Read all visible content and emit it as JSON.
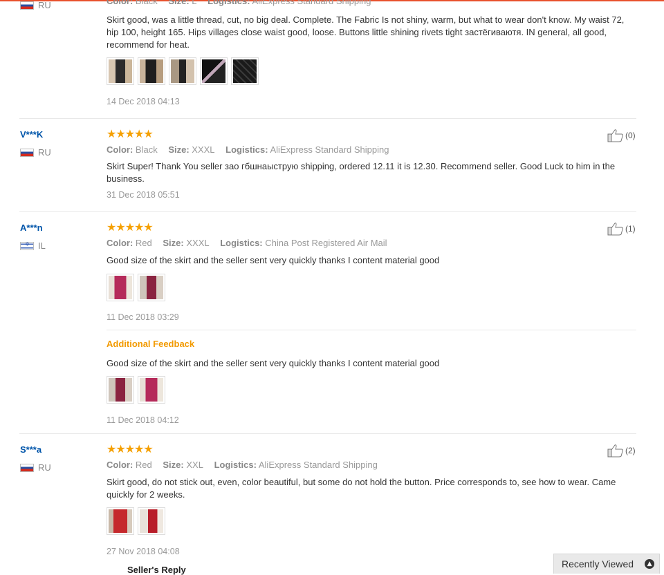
{
  "labels": {
    "color": "Color:",
    "size": "Size:",
    "logistics": "Logistics:"
  },
  "reviews": [
    {
      "user": "",
      "country": "RU",
      "color": "Black",
      "size": "L",
      "logistics": "AliExpress Standard Shipping",
      "text": "Skirt good, was a little thread, cut, no big deal. Complete. The Fabric Is not shiny, warm, but what to wear don't know. My waist 72, hip 100, height 165. Hips villages close waist good, loose. Buttons little shining rivets tight застёгиваютя. IN general, all good, recommend for heat.",
      "date": "14 Dec 2018 04:13"
    },
    {
      "user": "V***K",
      "country": "RU",
      "stars": "★★★★★",
      "color": "Black",
      "size": "XXXL",
      "logistics": "AliExpress Standard Shipping",
      "text": "Skirt Super! Thank You seller зао гбшнаыструю shipping, ordered 12.11 it is 12.30. Recommend seller. Good Luck to him in the business.",
      "date": "31 Dec 2018 05:51",
      "likes": "(0)"
    },
    {
      "user": "A***n",
      "country": "IL",
      "stars": "★★★★★",
      "color": "Red",
      "size": "XXXL",
      "logistics": "China Post Registered Air Mail",
      "text": "Good size of the skirt and the seller sent very quickly thanks I content material good",
      "date": "11 Dec 2018 03:29",
      "likes": "(1)",
      "additional": {
        "title": "Additional Feedback",
        "text": "Good size of the skirt and the seller sent very quickly thanks I content material good",
        "date": "11 Dec 2018 04:12"
      }
    },
    {
      "user": "S***a",
      "country": "RU",
      "stars": "★★★★★",
      "color": "Red",
      "size": "XXL",
      "logistics": "AliExpress Standard Shipping",
      "text": "Skirt good, do not stick out, even, color beautiful, but some do not hold the button. Price corresponds to, see how to wear. Came quickly for 2 weeks.",
      "date": "27 Nov 2018 04:08",
      "likes": "(2)"
    }
  ],
  "seller_reply": "Seller's Reply",
  "recently_viewed": "Recently Viewed",
  "colors": {
    "accent": "#e8512d",
    "stars": "#f5a000",
    "username": "#0055aa",
    "additional": "#f29a00"
  }
}
